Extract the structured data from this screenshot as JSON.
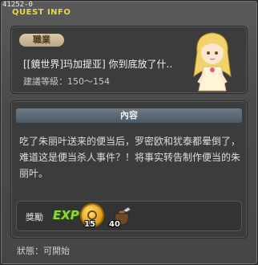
{
  "quest_id": "41252-0",
  "window_title": "QUEST INFO",
  "category_tag": "職業",
  "quest_name": "[[鏡世界]玛加提亚] 你到底放了什..",
  "level_req": "建議等級：150～154",
  "content_header": "內容",
  "description": "吃了朱丽叶送来的便当后，罗密欧和犹泰都晕倒了，难道这是便当杀人事件？！将事实转告制作便当的朱丽叶。",
  "reward": {
    "label": "獎勵",
    "exp_label": "EXP",
    "items": [
      {
        "icon": "gold-coin-icon",
        "count": "15"
      },
      {
        "icon": "item-bag-icon",
        "count": "40"
      }
    ]
  },
  "status": "狀態：可開始",
  "colors": {
    "title": "#e8d44a",
    "exp": "#8ad83a"
  }
}
